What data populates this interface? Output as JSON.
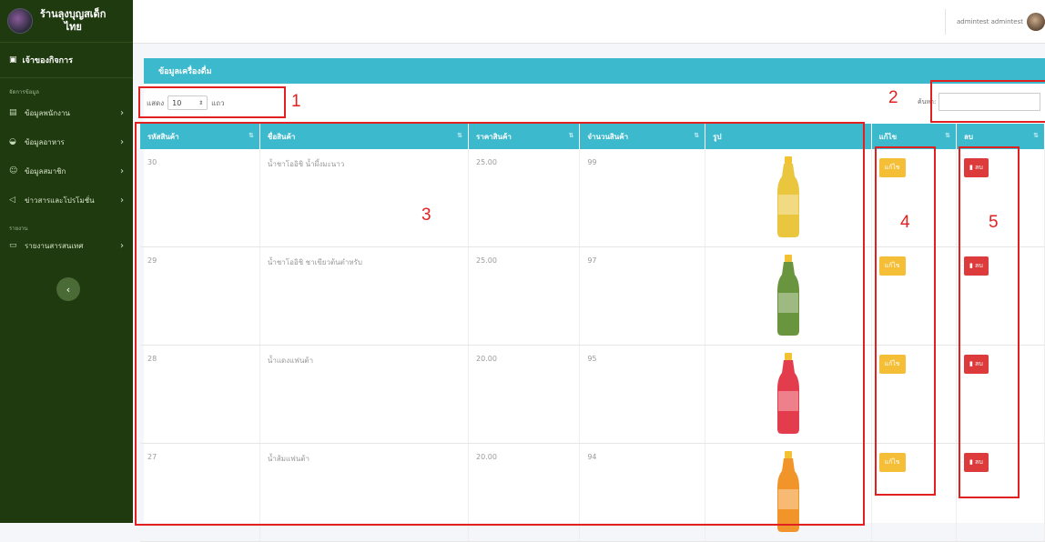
{
  "sidebar": {
    "brand_line1": "ร้านลุงบุญสเด็ก",
    "brand_line2": "ไทย",
    "owner_label": "เจ้าของกิจการ",
    "section_manage": "จัดการข้อมูล",
    "section_report": "รายงาน",
    "items": [
      {
        "label": "ข้อมูลพนักงาน",
        "icon": "id-card-icon"
      },
      {
        "label": "ข้อมูลอาหาร",
        "icon": "dish-icon"
      },
      {
        "label": "ข้อมูลสมาชิก",
        "icon": "users-icon"
      },
      {
        "label": "ข่าวสารและโปรโมชั่น",
        "icon": "megaphone-icon"
      }
    ],
    "report_item": "รายงานสารสนเทศ",
    "collapse_icon": "‹"
  },
  "topbar": {
    "user_name": "admintest admintest"
  },
  "panel": {
    "title": "ข้อมูลเครื่องดื่ม",
    "length_prefix": "แสดง",
    "length_value": "10",
    "length_suffix": "แถว",
    "search_label": "ค้นหา:"
  },
  "table": {
    "headers": [
      "รหัสสินค้า",
      "ชื่อสินค้า",
      "ราคาสินค้า",
      "จำนวนสินค้า",
      "รูป",
      "แก้ไข",
      "ลบ"
    ],
    "edit_label": "แก้ไข",
    "delete_label": "ลบ",
    "rows": [
      {
        "id": "30",
        "name": "น้ำชาโออิชิ น้ำผึ้งมะนาว",
        "price": "25.00",
        "qty": "99",
        "bottle_color": "#e8c02a"
      },
      {
        "id": "29",
        "name": "น้ำชาโออิชิ ชาเขียวต้นตำหรับ",
        "price": "25.00",
        "qty": "97",
        "bottle_color": "#5a8a2a"
      },
      {
        "id": "28",
        "name": "น้ำแดงแฟนต้า",
        "price": "20.00",
        "qty": "95",
        "bottle_color": "#e0283a"
      },
      {
        "id": "27",
        "name": "น้ำส้มแฟนต้า",
        "price": "20.00",
        "qty": "94",
        "bottle_color": "#f08a14"
      }
    ]
  },
  "annotations": [
    "1",
    "2",
    "3",
    "4",
    "5"
  ],
  "colors": {
    "accent": "#3cb9cc",
    "sidebar": "#1f3a0e",
    "edit": "#f4be37",
    "delete": "#dd3b3b",
    "annotation": "#e32020"
  }
}
